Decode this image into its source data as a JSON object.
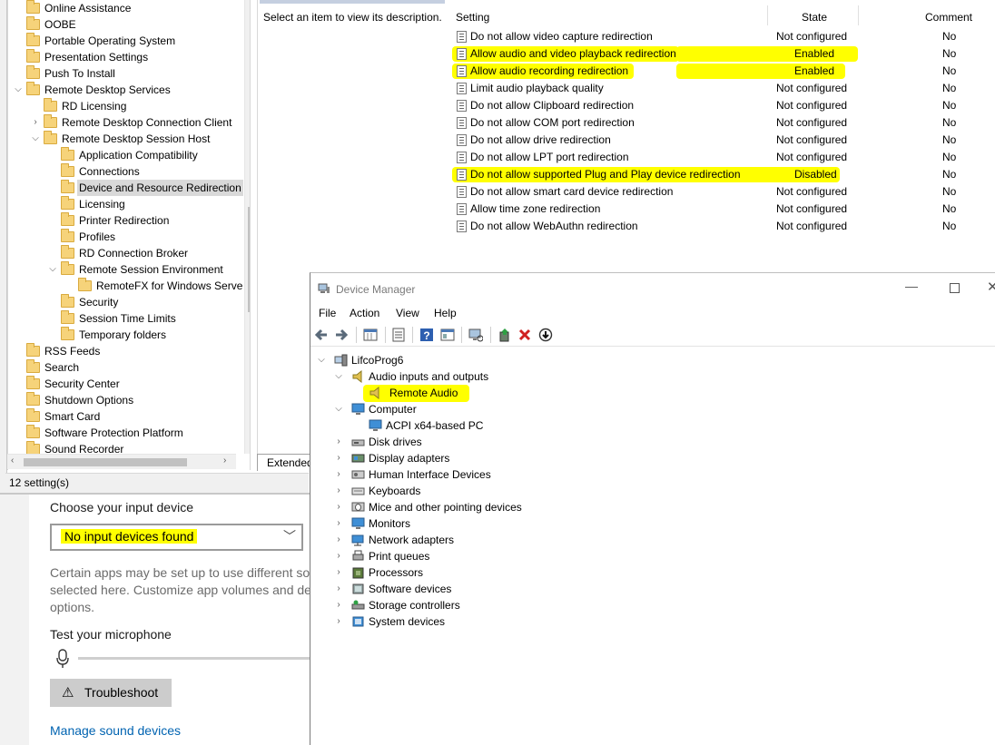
{
  "gpedit": {
    "tree": [
      {
        "label": "Online Assistance",
        "expand": ""
      },
      {
        "label": "OOBE",
        "expand": ""
      },
      {
        "label": "Portable Operating System",
        "expand": ""
      },
      {
        "label": "Presentation Settings",
        "expand": ""
      },
      {
        "label": "Push To Install",
        "expand": ""
      },
      {
        "label": "Remote Desktop Services",
        "expand": "expanded"
      },
      {
        "label": "RD Licensing",
        "expand": ""
      },
      {
        "label": "Remote Desktop Connection Client",
        "expand": "collapsed"
      },
      {
        "label": "Remote Desktop Session Host",
        "expand": "expanded"
      },
      {
        "label": "Application Compatibility",
        "expand": ""
      },
      {
        "label": "Connections",
        "expand": ""
      },
      {
        "label": "Device and Resource Redirection",
        "expand": "",
        "selected": true
      },
      {
        "label": "Licensing",
        "expand": ""
      },
      {
        "label": "Printer Redirection",
        "expand": ""
      },
      {
        "label": "Profiles",
        "expand": ""
      },
      {
        "label": "RD Connection Broker",
        "expand": ""
      },
      {
        "label": "Remote Session Environment",
        "expand": "expanded"
      },
      {
        "label": "RemoteFX for Windows Serve",
        "expand": ""
      },
      {
        "label": "Security",
        "expand": ""
      },
      {
        "label": "Session Time Limits",
        "expand": ""
      },
      {
        "label": "Temporary folders",
        "expand": ""
      },
      {
        "label": "RSS Feeds",
        "expand": ""
      },
      {
        "label": "Search",
        "expand": ""
      },
      {
        "label": "Security Center",
        "expand": ""
      },
      {
        "label": "Shutdown Options",
        "expand": ""
      },
      {
        "label": "Smart Card",
        "expand": ""
      },
      {
        "label": "Software Protection Platform",
        "expand": ""
      },
      {
        "label": "Sound Recorder",
        "expand": ""
      }
    ],
    "description": "Select an item to view its description.",
    "columns": {
      "setting": "Setting",
      "state": "State",
      "comment": "Comment"
    },
    "settings": [
      {
        "name": "Do not allow video capture redirection",
        "state": "Not configured",
        "comment": "No",
        "highlight": false
      },
      {
        "name": "Allow audio and video playback redirection",
        "state": "Enabled",
        "comment": "No",
        "highlight": true
      },
      {
        "name": "Allow audio recording redirection",
        "state": "Enabled",
        "comment": "No",
        "highlight": true
      },
      {
        "name": "Limit audio playback quality",
        "state": "Not configured",
        "comment": "No",
        "highlight": false
      },
      {
        "name": "Do not allow Clipboard redirection",
        "state": "Not configured",
        "comment": "No",
        "highlight": false
      },
      {
        "name": "Do not allow COM port redirection",
        "state": "Not configured",
        "comment": "No",
        "highlight": false
      },
      {
        "name": "Do not allow drive redirection",
        "state": "Not configured",
        "comment": "No",
        "highlight": false
      },
      {
        "name": "Do not allow LPT port redirection",
        "state": "Not configured",
        "comment": "No",
        "highlight": false
      },
      {
        "name": "Do not allow supported Plug and Play device redirection",
        "state": "Disabled",
        "comment": "No",
        "highlight": true
      },
      {
        "name": "Do not allow smart card device redirection",
        "state": "Not configured",
        "comment": "No",
        "highlight": false
      },
      {
        "name": "Allow time zone redirection",
        "state": "Not configured",
        "comment": "No",
        "highlight": false
      },
      {
        "name": "Do not allow WebAuthn redirection",
        "state": "Not configured",
        "comment": "No",
        "highlight": false
      }
    ],
    "extended_tab": "Extended",
    "status": "12 setting(s)"
  },
  "sound": {
    "choose_label": "Choose your input device",
    "dropdown_value": "No input devices found",
    "note_lines": [
      "Certain apps may be set up to use different so",
      "selected here. Customize app volumes and dev",
      "options."
    ],
    "test_label": "Test your microphone",
    "troubleshoot": "Troubleshoot",
    "manage_link": "Manage sound devices"
  },
  "devmgr": {
    "title": "Device Manager",
    "menu": [
      "File",
      "Action",
      "View",
      "Help"
    ],
    "tree": [
      {
        "label": "LifcoProg6",
        "expand": "expanded",
        "icon": "computer-root-icon"
      },
      {
        "label": "Audio inputs and outputs",
        "expand": "expanded",
        "icon": "speaker-icon"
      },
      {
        "label": "Remote Audio",
        "expand": "",
        "icon": "speaker-icon",
        "highlight": true
      },
      {
        "label": "Computer",
        "expand": "expanded",
        "icon": "monitor-icon"
      },
      {
        "label": "ACPI x64-based PC",
        "expand": "",
        "icon": "monitor-icon"
      },
      {
        "label": "Disk drives",
        "expand": "collapsed",
        "icon": "disk-drive-icon"
      },
      {
        "label": "Display adapters",
        "expand": "collapsed",
        "icon": "display-adapter-icon"
      },
      {
        "label": "Human Interface Devices",
        "expand": "collapsed",
        "icon": "hid-icon"
      },
      {
        "label": "Keyboards",
        "expand": "collapsed",
        "icon": "keyboard-icon"
      },
      {
        "label": "Mice and other pointing devices",
        "expand": "collapsed",
        "icon": "mouse-icon"
      },
      {
        "label": "Monitors",
        "expand": "collapsed",
        "icon": "monitor-icon"
      },
      {
        "label": "Network adapters",
        "expand": "collapsed",
        "icon": "network-adapter-icon"
      },
      {
        "label": "Print queues",
        "expand": "collapsed",
        "icon": "printer-icon"
      },
      {
        "label": "Processors",
        "expand": "collapsed",
        "icon": "processor-icon"
      },
      {
        "label": "Software devices",
        "expand": "collapsed",
        "icon": "software-device-icon"
      },
      {
        "label": "Storage controllers",
        "expand": "collapsed",
        "icon": "storage-controller-icon"
      },
      {
        "label": "System devices",
        "expand": "collapsed",
        "icon": "system-devices-icon"
      }
    ]
  },
  "colors": {
    "highlight": "#ffff00",
    "link": "#0063b1",
    "folder": "#f6d37a"
  }
}
